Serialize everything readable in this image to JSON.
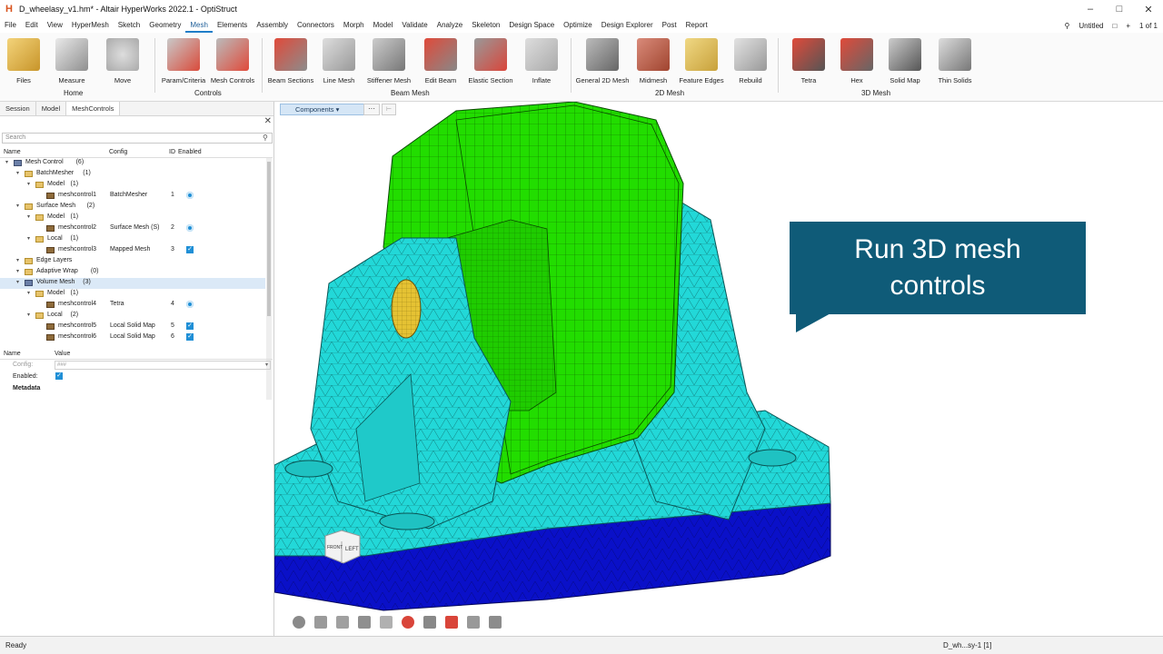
{
  "window": {
    "title": "D_wheelasy_v1.hm* - Altair HyperWorks 2022.1 - OptiStruct",
    "logo": "H"
  },
  "menu": {
    "items": [
      "File",
      "Edit",
      "View",
      "HyperMesh",
      "Sketch",
      "Geometry",
      "Mesh",
      "Elements",
      "Assembly",
      "Connectors",
      "Morph",
      "Model",
      "Validate",
      "Analyze",
      "Skeleton",
      "Design Space",
      "Optimize",
      "Design Explorer",
      "Post",
      "Report"
    ],
    "active": "Mesh",
    "session_name": "Untitled",
    "page_indicator": "1 of 1"
  },
  "ribbon": {
    "tools": [
      {
        "label": "Files"
      },
      {
        "label": "Measure"
      },
      {
        "label": "Move"
      },
      {
        "label": "Param/Criteria"
      },
      {
        "label": "Mesh Controls"
      },
      {
        "label": "Beam Sections"
      },
      {
        "label": "Line Mesh"
      },
      {
        "label": "Stiffener Mesh"
      },
      {
        "label": "Edit Beam"
      },
      {
        "label": "Elastic Section"
      },
      {
        "label": "Inflate"
      },
      {
        "label": "General 2D Mesh"
      },
      {
        "label": "Midmesh"
      },
      {
        "label": "Feature Edges"
      },
      {
        "label": "Rebuild"
      },
      {
        "label": "Tetra"
      },
      {
        "label": "Hex"
      },
      {
        "label": "Solid Map"
      },
      {
        "label": "Thin Solids"
      }
    ],
    "groups": [
      "Home",
      "Controls",
      "Beam Mesh",
      "2D Mesh",
      "3D Mesh"
    ]
  },
  "panel": {
    "tabs": [
      "Session",
      "Model",
      "MeshControls"
    ],
    "active_tab": "MeshControls",
    "search_placeholder": "Search",
    "columns": {
      "name": "Name",
      "config": "Config",
      "id": "ID",
      "enabled": "Enabled"
    },
    "tree": [
      {
        "name": "Mesh Control",
        "count": "(6)",
        "level": 0,
        "icon": "group"
      },
      {
        "name": "BatchMesher",
        "count": "(1)",
        "level": 1,
        "icon": "folder"
      },
      {
        "name": "Model",
        "count": "(1)",
        "level": 2,
        "icon": "folder"
      },
      {
        "name": "meshcontrol1",
        "count": "",
        "level": 3,
        "icon": "mc",
        "config": "BatchMesher",
        "id": "1",
        "enabled": "radio"
      },
      {
        "name": "Surface Mesh",
        "count": "(2)",
        "level": 1,
        "icon": "folder"
      },
      {
        "name": "Model",
        "count": "(1)",
        "level": 2,
        "icon": "folder"
      },
      {
        "name": "meshcontrol2",
        "count": "",
        "level": 3,
        "icon": "mc",
        "config": "Surface Mesh (S)",
        "id": "2",
        "enabled": "radio"
      },
      {
        "name": "Local",
        "count": "(1)",
        "level": 2,
        "icon": "folder"
      },
      {
        "name": "meshcontrol3",
        "count": "",
        "level": 3,
        "icon": "mc",
        "config": "Mapped Mesh",
        "id": "3",
        "enabled": "check"
      },
      {
        "name": "Edge Layers",
        "count": "",
        "level": 1,
        "icon": "folder"
      },
      {
        "name": "Adaptive Wrap",
        "count": "(0)",
        "level": 1,
        "icon": "folder"
      },
      {
        "name": "Volume Mesh",
        "count": "(3)",
        "level": 1,
        "icon": "group",
        "selected": true
      },
      {
        "name": "Model",
        "count": "(1)",
        "level": 2,
        "icon": "folder"
      },
      {
        "name": "meshcontrol4",
        "count": "",
        "level": 3,
        "icon": "mc",
        "config": "Tetra",
        "id": "4",
        "enabled": "radio"
      },
      {
        "name": "Local",
        "count": "(2)",
        "level": 2,
        "icon": "folder"
      },
      {
        "name": "meshcontrol5",
        "count": "",
        "level": 3,
        "icon": "mc",
        "config": "Local Solid Map",
        "id": "5",
        "enabled": "check"
      },
      {
        "name": "meshcontrol6",
        "count": "",
        "level": 3,
        "icon": "mc",
        "config": "Local Solid Map",
        "id": "6",
        "enabled": "check"
      }
    ],
    "props": {
      "col_name": "Name",
      "col_value": "Value",
      "config_label": "Config:",
      "config_value": "###",
      "enabled_label": "Enabled:",
      "metadata_label": "Metadata"
    }
  },
  "viewport": {
    "components_label": "Components",
    "more_label": "···",
    "callout_line1": "Run 3D mesh",
    "callout_line2": "controls",
    "cube_front": "FRONT",
    "cube_left": "LEFT"
  },
  "status": {
    "text": "Ready",
    "model": "D_wh...sy-1 [1]"
  },
  "colors": {
    "mesh_green": "#22dd00",
    "mesh_cyan": "#22d8d8",
    "mesh_blue": "#0a10c8",
    "callout_bg": "#0f5b78",
    "accent": "#1f8fd6"
  }
}
